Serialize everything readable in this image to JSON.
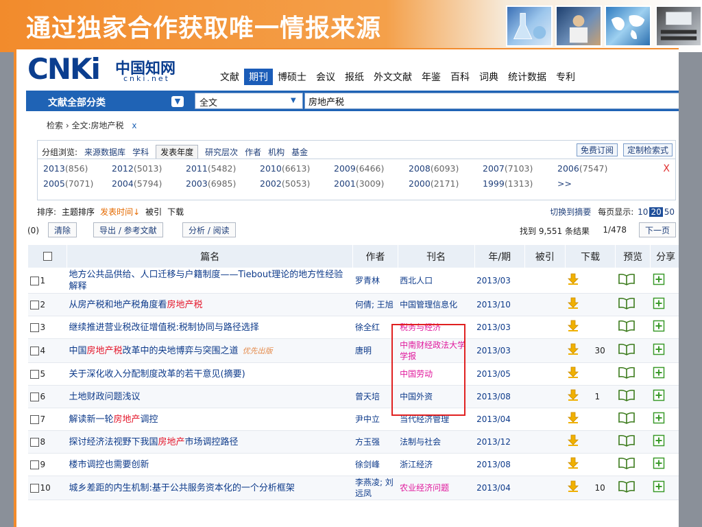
{
  "slide": {
    "title": "通过独家合作获取唯一情报来源"
  },
  "logo": {
    "brand": "CNKi",
    "cn": "中国知网",
    "url": "cnki.net"
  },
  "nav": [
    {
      "label": "文献",
      "active": false
    },
    {
      "label": "期刊",
      "active": true
    },
    {
      "label": "博硕士",
      "active": false
    },
    {
      "label": "会议",
      "active": false
    },
    {
      "label": "报纸",
      "active": false
    },
    {
      "label": "外文文献",
      "active": false
    },
    {
      "label": "年鉴",
      "active": false
    },
    {
      "label": "百科",
      "active": false
    },
    {
      "label": "词典",
      "active": false
    },
    {
      "label": "统计数据",
      "active": false
    },
    {
      "label": "专利",
      "active": false
    }
  ],
  "search": {
    "category": "文献全部分类",
    "field": "全文",
    "query": "房地产税"
  },
  "breadcrumb": {
    "root": "检索",
    "current": "全文:房地产税",
    "close": "x"
  },
  "group": {
    "label": "分组浏览:",
    "tabs": [
      {
        "label": "来源数据库",
        "active": false
      },
      {
        "label": "学科",
        "active": false
      },
      {
        "label": "发表年度",
        "active": true
      },
      {
        "label": "研究层次",
        "active": false
      },
      {
        "label": "作者",
        "active": false
      },
      {
        "label": "机构",
        "active": false
      },
      {
        "label": "基金",
        "active": false
      }
    ],
    "subscribe": "免费订阅",
    "custom": "定制检索式",
    "close": "X",
    "years": [
      {
        "year": "2013",
        "count": "(856)"
      },
      {
        "year": "2012",
        "count": "(5013)"
      },
      {
        "year": "2011",
        "count": "(5482)"
      },
      {
        "year": "2010",
        "count": "(6613)"
      },
      {
        "year": "2009",
        "count": "(6466)"
      },
      {
        "year": "2008",
        "count": "(6093)"
      },
      {
        "year": "2007",
        "count": "(7103)"
      },
      {
        "year": "2006",
        "count": "(7547)"
      },
      {
        "year": "2005",
        "count": "(7071)"
      },
      {
        "year": "2004",
        "count": "(5794)"
      },
      {
        "year": "2003",
        "count": "(6985)"
      },
      {
        "year": "2002",
        "count": "(5053)"
      },
      {
        "year": "2001",
        "count": "(3009)"
      },
      {
        "year": "2000",
        "count": "(2171)"
      },
      {
        "year": "1999",
        "count": "(1313)"
      },
      {
        "year": ">>",
        "count": ""
      }
    ]
  },
  "sort": {
    "label": "排序:",
    "options": [
      {
        "label": "主题排序",
        "active": false
      },
      {
        "label": "发表时间↓",
        "active": true
      },
      {
        "label": "被引",
        "active": false
      },
      {
        "label": "下载",
        "active": false
      }
    ],
    "switch": "切换到摘要",
    "per_page_label": "每页显示:",
    "per_page": [
      {
        "label": "10",
        "active": false
      },
      {
        "label": "20",
        "active": true
      },
      {
        "label": "50",
        "active": false
      }
    ]
  },
  "actions": {
    "count": "(0)",
    "clear": "清除",
    "export": "导出 / 参考文献",
    "analyze": "分析 / 阅读",
    "result_info": "找到 9,551 条结果",
    "page_info": "1/478",
    "next": "下一页"
  },
  "columns": [
    "篇名",
    "作者",
    "刊名",
    "年/期",
    "被引",
    "下载",
    "预览",
    "分享"
  ],
  "rows": [
    {
      "n": "1",
      "pre": "地方公共品供给、人口迁移与户籍制度——Tiebout理论的地方性经验解释",
      "hl": "",
      "post": "",
      "tag": "",
      "author": "罗青林",
      "journal": "西北人口",
      "pink": false,
      "year": "2013/03",
      "cited": "",
      "dl": ""
    },
    {
      "n": "2",
      "pre": "从房产税和地产税角度看",
      "hl": "房地产税",
      "post": "",
      "tag": "",
      "author": "何倩; 王旭",
      "journal": "中国管理信息化",
      "pink": false,
      "year": "2013/10",
      "cited": "",
      "dl": ""
    },
    {
      "n": "3",
      "pre": "继续推进营业税改征增值税:税制协同与路径选择",
      "hl": "",
      "post": "",
      "tag": "",
      "author": "徐全红",
      "journal": "税务与经济",
      "pink": true,
      "year": "2013/03",
      "cited": "",
      "dl": ""
    },
    {
      "n": "4",
      "pre": "中国",
      "hl": "房地产税",
      "post": "改革中的央地博弈与突围之道",
      "tag": "优先出版",
      "author": "唐明",
      "journal": "中南财经政法大学学报",
      "pink": true,
      "year": "2013/03",
      "cited": "",
      "dl": "30"
    },
    {
      "n": "5",
      "pre": "关于深化收入分配制度改革的若干意见(摘要)",
      "hl": "",
      "post": "",
      "tag": "",
      "author": "",
      "journal": "中国劳动",
      "pink": true,
      "year": "2013/05",
      "cited": "",
      "dl": ""
    },
    {
      "n": "6",
      "pre": "土地财政问题浅议",
      "hl": "",
      "post": "",
      "tag": "",
      "author": "曾天培",
      "journal": "中国外资",
      "pink": false,
      "year": "2013/08",
      "cited": "",
      "dl": "1"
    },
    {
      "n": "7",
      "pre": "解读新一轮",
      "hl": "房地产",
      "post": "调控",
      "tag": "",
      "author": "尹中立",
      "journal": "当代经济管理",
      "pink": false,
      "year": "2013/04",
      "cited": "",
      "dl": ""
    },
    {
      "n": "8",
      "pre": "探讨经济法视野下我国",
      "hl": "房地产",
      "post": "市场调控路径",
      "tag": "",
      "author": "方玉强",
      "journal": "法制与社会",
      "pink": false,
      "year": "2013/12",
      "cited": "",
      "dl": ""
    },
    {
      "n": "9",
      "pre": "楼市调控也需要创新",
      "hl": "",
      "post": "",
      "tag": "",
      "author": "徐剑峰",
      "journal": "浙江经济",
      "pink": false,
      "year": "2013/08",
      "cited": "",
      "dl": ""
    },
    {
      "n": "10",
      "pre": "城乡差距的内生机制:基于公共服务资本化的一个分析框架",
      "hl": "",
      "post": "",
      "tag": "",
      "author": "李燕凌; 刘远凤",
      "journal": "农业经济问题",
      "pink": true,
      "year": "2013/04",
      "cited": "",
      "dl": "10"
    }
  ],
  "colors": {
    "accent": "#1f63b5",
    "highlight": "#e4162a",
    "pink": "#e0189c",
    "slide": "#f28b2c"
  }
}
